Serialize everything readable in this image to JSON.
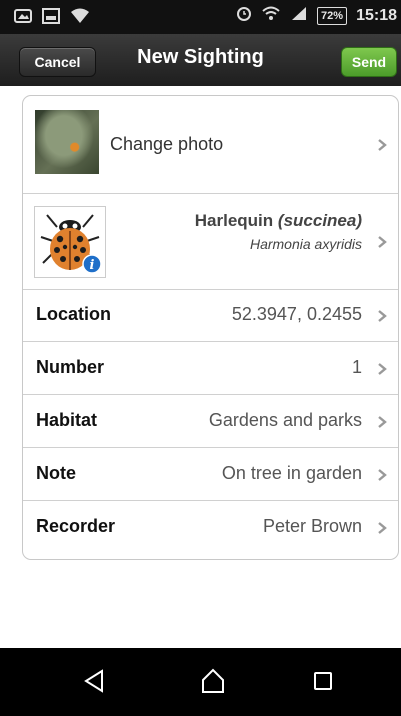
{
  "status_bar": {
    "battery": "72%",
    "time": "15:18"
  },
  "header": {
    "cancel_label": "Cancel",
    "title": "New Sighting",
    "send_label": "Send"
  },
  "photo_row": {
    "label": "Change photo"
  },
  "species_row": {
    "common_name": "Harlequin",
    "variant": "(succinea)",
    "scientific_name": "Harmonia axyridis"
  },
  "fields": [
    {
      "label": "Location",
      "value": "52.3947, 0.2455"
    },
    {
      "label": "Number",
      "value": "1"
    },
    {
      "label": "Habitat",
      "value": "Gardens and parks"
    },
    {
      "label": "Note",
      "value": "On tree in garden"
    },
    {
      "label": "Recorder",
      "value": "Peter Brown"
    }
  ],
  "colors": {
    "send_green": "#5aa832",
    "header_dark": "#2a2a2a"
  }
}
